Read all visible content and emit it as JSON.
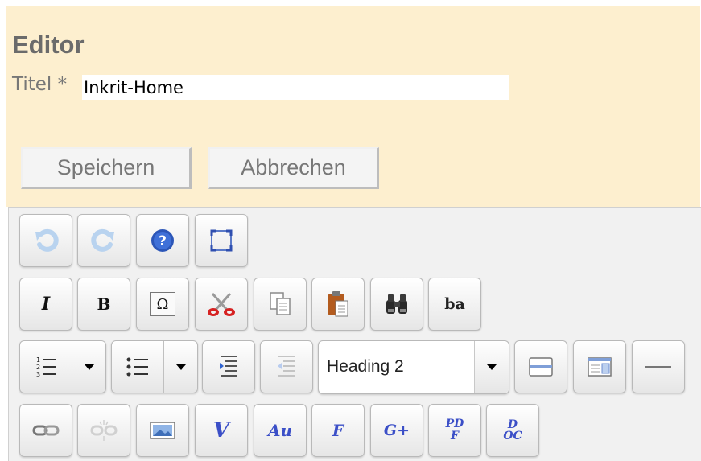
{
  "editor": {
    "title": "Editor",
    "title_label": "Titel *",
    "title_value": "Inkrit-Home",
    "save_label": "Speichern",
    "cancel_label": "Abbrechen"
  },
  "toolbar": {
    "format_value": "Heading 2",
    "italic_label": "I",
    "bold_label": "B",
    "special_char_label": "Ω",
    "subscript_label": "ba",
    "plugin_v_label": "V",
    "plugin_au_label": "Au",
    "plugin_f_label": "F",
    "plugin_gplus_label": "G+",
    "plugin_pdf_label": "PDF",
    "plugin_doc_label": "DOC"
  },
  "colors": {
    "panel_bg": "#fdefcf",
    "toolbar_bg": "#f1f1f1",
    "accent_blue": "#3b4fc7"
  },
  "icons": [
    "undo-icon",
    "redo-icon",
    "help-icon",
    "maximize-icon",
    "italic-icon",
    "bold-icon",
    "special-char-icon",
    "cut-icon",
    "copy-icon",
    "paste-icon",
    "find-icon",
    "subscript-icon",
    "numbered-list-icon",
    "bullet-list-icon",
    "indent-icon",
    "outdent-icon",
    "div-icon",
    "template-icon",
    "horizontal-rule-icon",
    "link-icon",
    "unlink-icon",
    "image-icon",
    "video-icon",
    "audio-icon",
    "flash-icon",
    "googleplus-icon",
    "pdf-icon",
    "doc-icon"
  ]
}
